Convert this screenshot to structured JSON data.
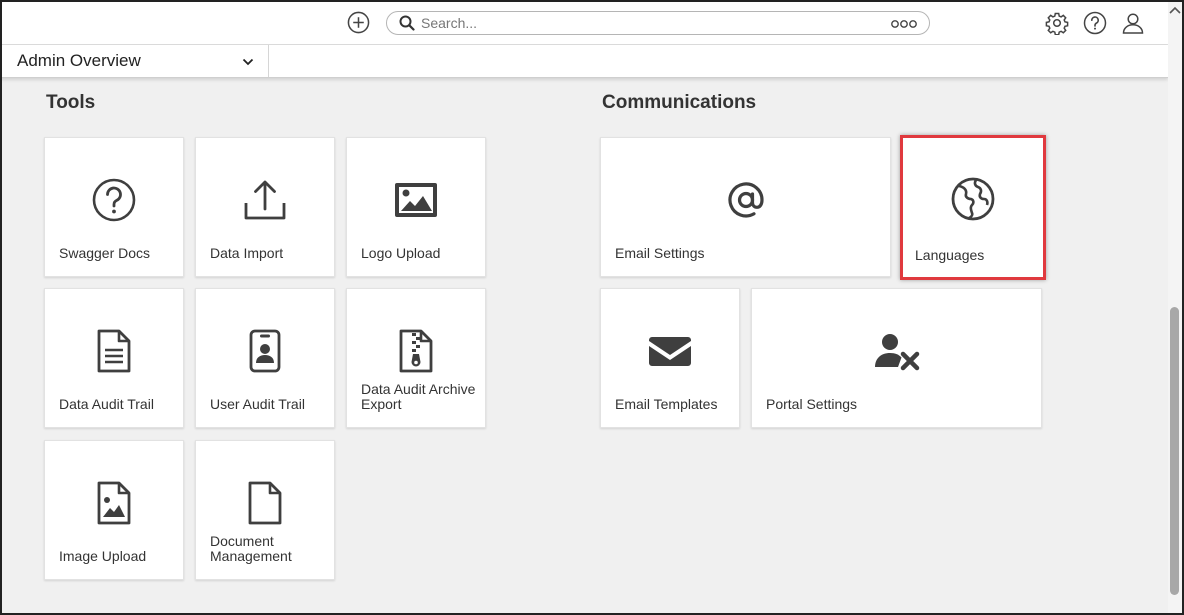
{
  "topbar": {
    "search_placeholder": "Search...",
    "icons": [
      "add-icon",
      "search-icon",
      "more-icon",
      "settings-icon",
      "help-icon",
      "user-icon"
    ]
  },
  "dashboard": {
    "selected": "Admin Overview"
  },
  "tools": {
    "title": "Tools",
    "tiles": [
      {
        "label": "Swagger Docs",
        "icon": "question-circle-icon"
      },
      {
        "label": "Data Import",
        "icon": "upload-icon"
      },
      {
        "label": "Logo Upload",
        "icon": "image-icon"
      },
      {
        "label": "Data Audit Trail",
        "icon": "document-icon"
      },
      {
        "label": "User Audit Trail",
        "icon": "id-badge-icon"
      },
      {
        "label": "Data Audit Archive Export",
        "icon": "zip-file-icon"
      },
      {
        "label": "Image Upload",
        "icon": "image-file-icon"
      },
      {
        "label": "Document Management",
        "icon": "blank-file-icon"
      }
    ]
  },
  "communications": {
    "title": "Communications",
    "tiles": [
      {
        "label": "Email Settings",
        "icon": "at-icon"
      },
      {
        "label": "Languages",
        "icon": "globe-icon"
      },
      {
        "label": "Email Templates",
        "icon": "envelope-icon"
      },
      {
        "label": "Portal Settings",
        "icon": "user-remove-icon"
      }
    ]
  },
  "colors": {
    "highlight": "#e0393e",
    "icon": "#3f3f3f",
    "scroll_thumb": "#a8a8a8"
  }
}
